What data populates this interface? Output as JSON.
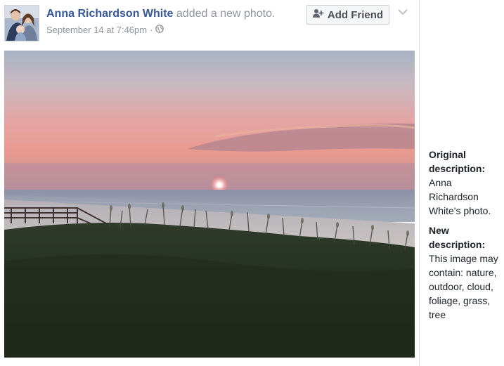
{
  "post": {
    "author_name": "Anna Richardson White",
    "action_text": "added a new photo.",
    "timestamp": "September 14 at 7:46pm",
    "separator": "·",
    "privacy_icon": "globe-icon",
    "add_friend_label": "Add Friend",
    "add_friend_icon": "add-person-icon",
    "menu_icon": "chevron-down-icon",
    "photo_subject": "beach sunset"
  },
  "side_panel": {
    "original_heading": "Original description:",
    "original_text": "Anna Richardson White's photo.",
    "new_heading": "New description:",
    "new_text": "This image may contain: nature, outdoor, cloud, foliage, grass, tree"
  },
  "colors": {
    "author_link": "#365899",
    "meta_grey": "#90949c",
    "button_bg": "#f6f7f9",
    "button_border": "#ccd0d5",
    "body_text": "#1d2129"
  }
}
